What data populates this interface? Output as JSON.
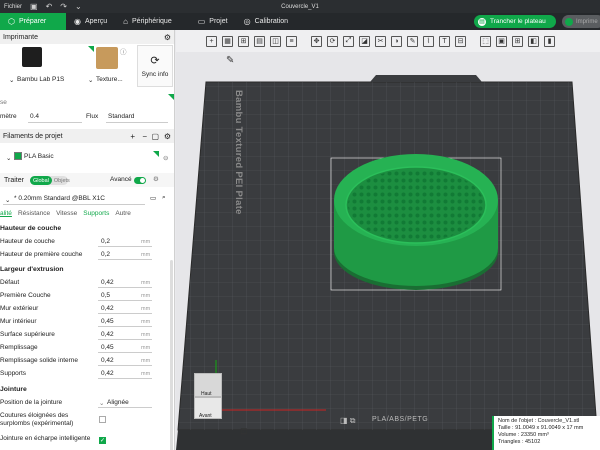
{
  "titlebar": {
    "file_menu": "Fichier",
    "doc_title": "Couvercle_V1"
  },
  "tabs": [
    {
      "label": "Préparer"
    },
    {
      "label": "Aperçu"
    },
    {
      "label": "Périphérique"
    },
    {
      "label": "Projet"
    },
    {
      "label": "Calibration"
    }
  ],
  "actions": {
    "slice_label": "Trancher le plateau",
    "print_label": "Imprime"
  },
  "printer_section": {
    "title": "Imprimante",
    "printer_name": "Bambu Lab P1S",
    "plate_name": "Texture...",
    "sync_label": "Sync info",
    "nozzle_label": "se",
    "diameter_label": "mètre",
    "diameter_value": "0.4",
    "flow_label": "Flux",
    "flow_value": "Standard"
  },
  "filament_section": {
    "title": "Filaments de projet",
    "filament_name": "PLA Basic"
  },
  "process_section": {
    "title": "Traiter",
    "global_label": "Global",
    "objects_label": "Objets",
    "advanced_label": "Avancé",
    "preset_name": "* 0.20mm Standard @BBL X1C"
  },
  "subtabs": [
    "alité",
    "Résistance",
    "Vitesse",
    "Supports",
    "Autre"
  ],
  "groups": {
    "layer_height": {
      "title": "Hauteur de couche",
      "rows": [
        {
          "label": "Hauteur de couche",
          "value": "0,2",
          "unit": "mm"
        },
        {
          "label": "Hauteur de première couche",
          "value": "0,2",
          "unit": "mm"
        }
      ]
    },
    "line_width": {
      "title": "Largeur d'extrusion",
      "rows": [
        {
          "label": "Défaut",
          "value": "0,42",
          "unit": "mm"
        },
        {
          "label": "Première Couche",
          "value": "0,5",
          "unit": "mm"
        },
        {
          "label": "Mur extérieur",
          "value": "0,42",
          "unit": "mm"
        },
        {
          "label": "Mur intérieur",
          "value": "0,45",
          "unit": "mm"
        },
        {
          "label": "Surface supérieure",
          "value": "0,42",
          "unit": "mm"
        },
        {
          "label": "Remplissage",
          "value": "0,45",
          "unit": "mm"
        },
        {
          "label": "Remplissage solide interne",
          "value": "0,42",
          "unit": "mm"
        },
        {
          "label": "Supports",
          "value": "0,42",
          "unit": "mm"
        }
      ]
    },
    "seam": {
      "title": "Jointure",
      "position_label": "Position de la jointure",
      "position_value": "Alignée",
      "gap_label": "Coutures éloignées des surplombs (expérimental)",
      "gap_checked": false,
      "scarf_label": "Jointure en écharpe intelligente",
      "scarf_checked": true
    }
  },
  "plate": {
    "texture_label": "Bambu Textured PEI Plate",
    "material_label": "PLA/ABS/PETG"
  },
  "object_info": {
    "name": "Nom de l'objet : Couvercle_V1.stl",
    "size": "Taille : 91.0049 x 91.0049 x 17 mm",
    "volume": "Volume : 23350 mm³",
    "triangles": "Triangles : 45102"
  },
  "view_cube": {
    "top_label": "Haut",
    "front_label": "Avant"
  },
  "colors": {
    "accent": "#10a84a",
    "plate": "#3a3c3f",
    "model": "#1f9a45"
  }
}
